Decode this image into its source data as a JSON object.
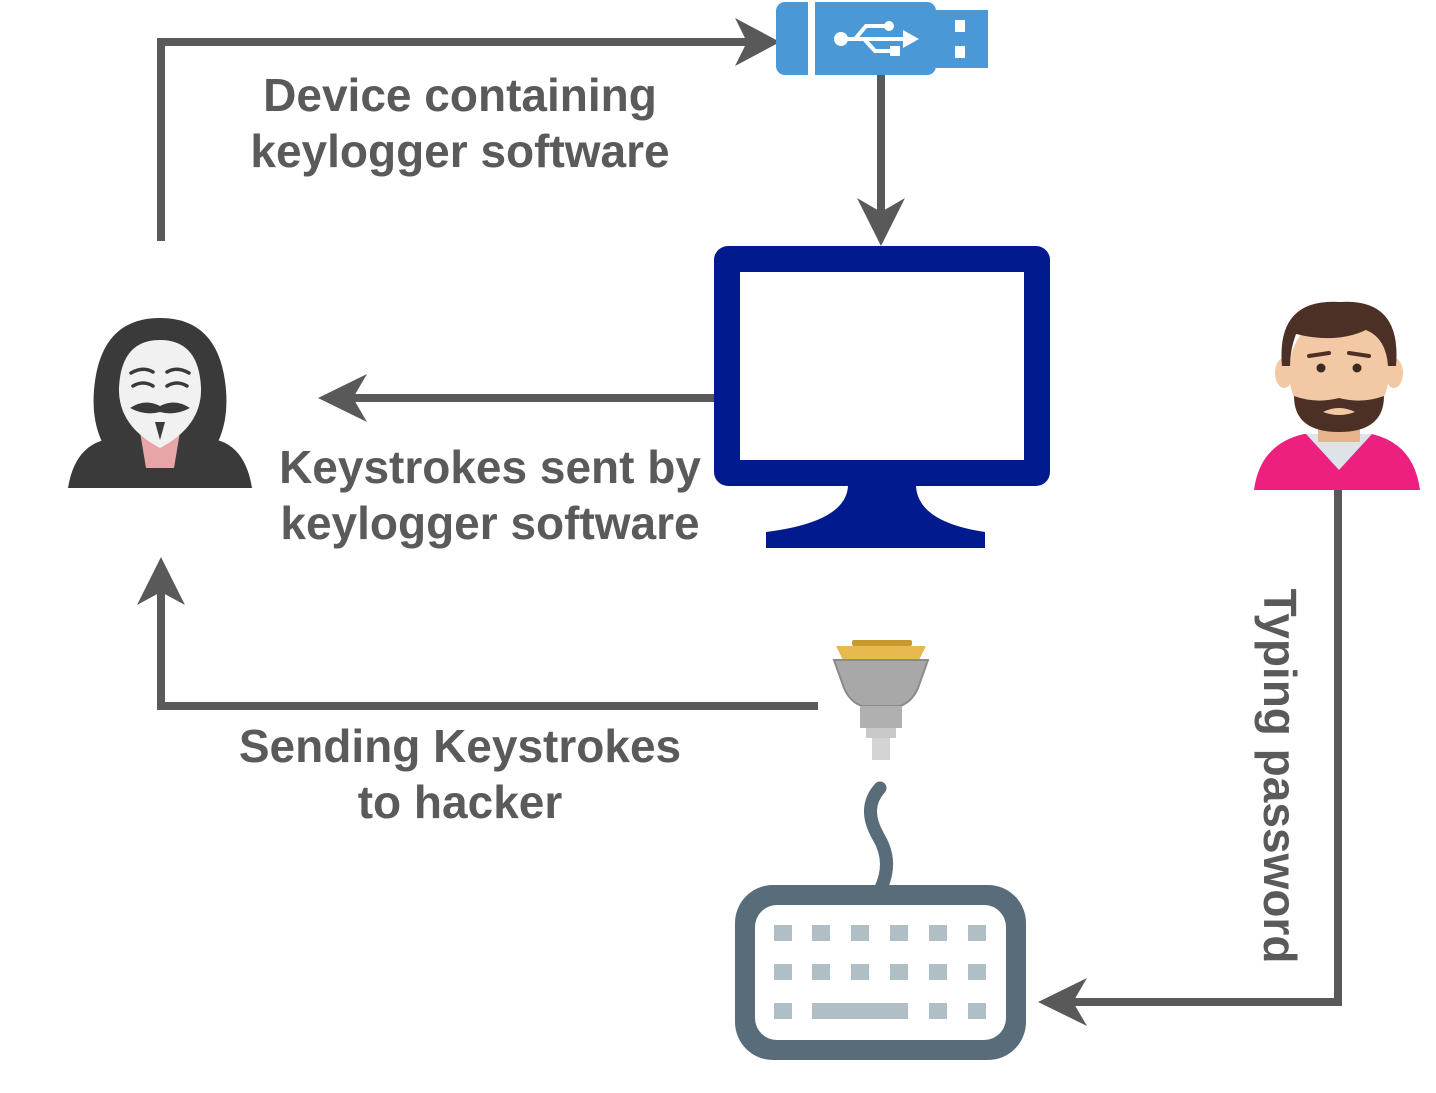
{
  "labels": {
    "device": [
      "Device containing",
      "keylogger software"
    ],
    "sent": [
      "Keystrokes sent by",
      "keylogger software"
    ],
    "sending": [
      "Sending Keystrokes",
      "to hacker"
    ],
    "typing": "Typing password"
  },
  "icons": {
    "hacker": "hacker-icon",
    "usb": "usb-drive-icon",
    "monitor": "computer-monitor-icon",
    "user": "user-icon",
    "connector": "serial-connector-icon",
    "keyboard": "keyboard-icon"
  },
  "colors": {
    "arrow": "#595959",
    "text": "#5a5a5a",
    "usb": "#4a98d6",
    "monitor": "#011b8f",
    "keyboard": "#586c79",
    "keyboard_keys": "#b0bec5",
    "user_shirt": "#ee207f",
    "user_skin": "#f2c9a4",
    "user_hair": "#4d3025",
    "hacker_hood": "#3a3a3a",
    "connector_gold": "#e7b94f",
    "connector_gray": "#9e9e9e"
  }
}
